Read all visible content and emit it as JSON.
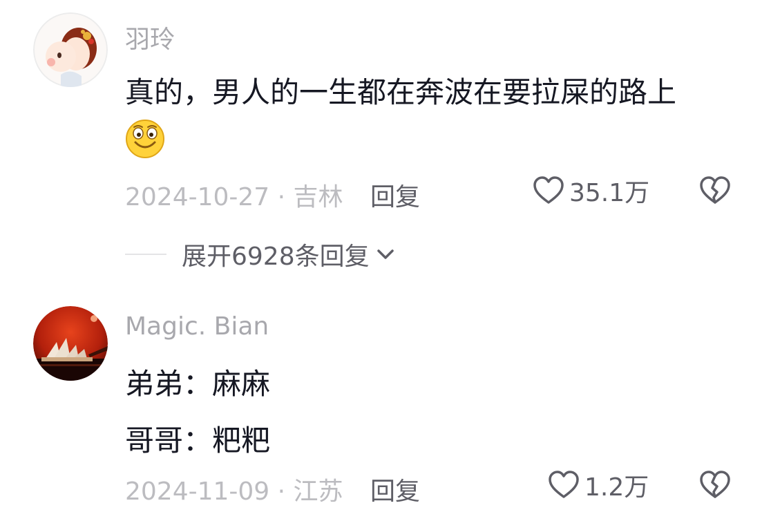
{
  "comments": [
    {
      "username": "羽玲",
      "lines": [
        "真的，男人的一生都在奔波在要拉屎的路上"
      ],
      "emoji": "smile-emoji",
      "date_location": "2024-10-27 · 吉林",
      "reply_label": "回复",
      "like_count": "35.1万",
      "expand_label": "展开6928条回复"
    },
    {
      "username": "Magic. Bian",
      "lines": [
        "弟弟：麻麻",
        "哥哥：粑粑"
      ],
      "date_location": "2024-11-09 · 江苏",
      "reply_label": "回复",
      "like_count": "1.2万"
    }
  ],
  "colors": {
    "username": "#a8a8ad",
    "text": "#161823",
    "meta": "#bcbcc0",
    "action": "#5e5e66"
  },
  "icons": {
    "like": "heart-outline-icon",
    "dislike": "broken-heart-icon",
    "expand": "chevron-down-icon"
  }
}
